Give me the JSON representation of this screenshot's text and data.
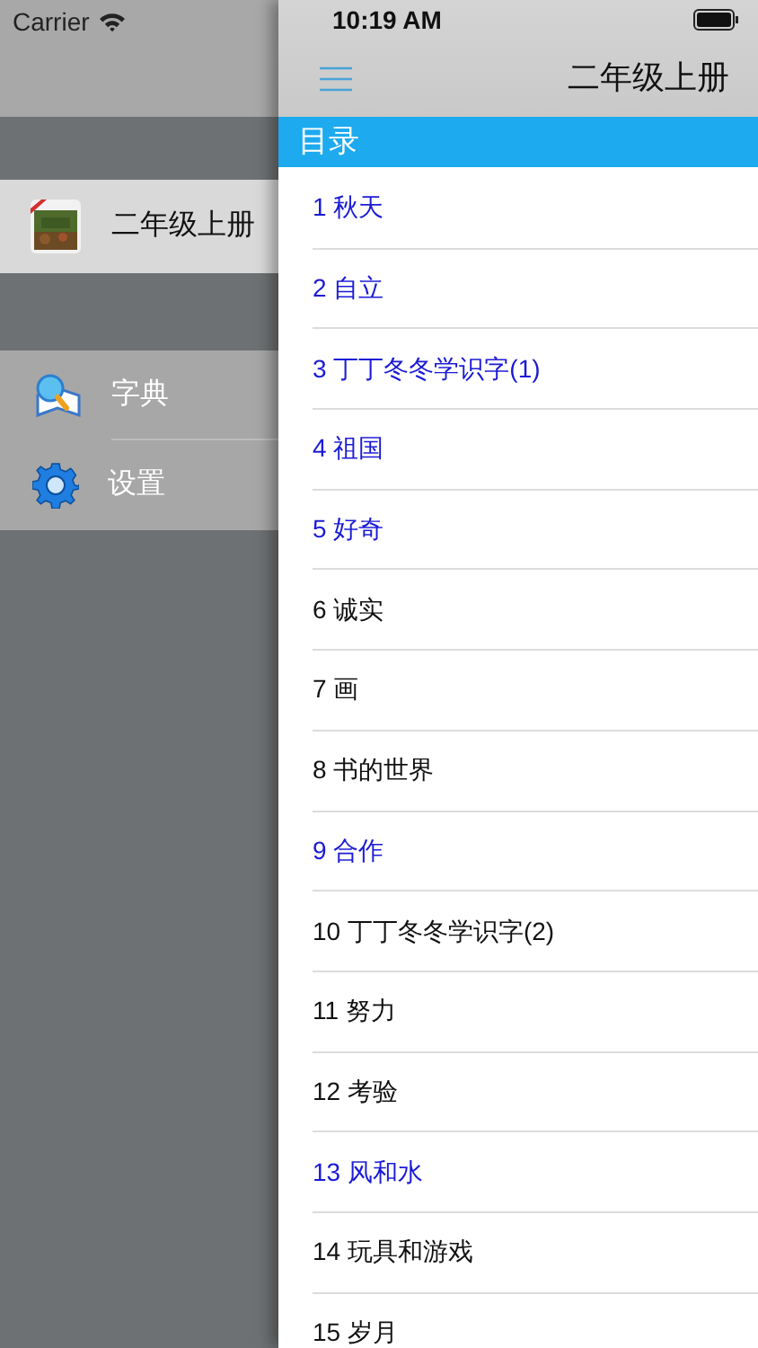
{
  "status_bar": {
    "carrier": "Carrier",
    "time": "10:19 AM"
  },
  "side_menu": {
    "books": [
      {
        "title": "二年级上册",
        "selected": true
      }
    ],
    "items": [
      {
        "kind": "dictionary",
        "label": "字典"
      },
      {
        "kind": "settings",
        "label": "设置"
      }
    ]
  },
  "header": {
    "title": "二年级上册"
  },
  "section": {
    "title": "目录"
  },
  "lessons": [
    {
      "title": "1 秋天",
      "color": "#1a1ad6"
    },
    {
      "title": "2 自立",
      "color": "#1a1ad6"
    },
    {
      "title": "3 丁丁冬冬学识字(1)",
      "color": "#1a1ad6"
    },
    {
      "title": "4 祖国",
      "color": "#1a1ad6"
    },
    {
      "title": "5 好奇",
      "color": "#1a1ad6"
    },
    {
      "title": "6 诚实",
      "color": "#111111"
    },
    {
      "title": "7 画",
      "color": "#111111"
    },
    {
      "title": "8 书的世界",
      "color": "#111111"
    },
    {
      "title": "9 合作",
      "color": "#1a1ad6"
    },
    {
      "title": "10 丁丁冬冬学识字(2)",
      "color": "#111111"
    },
    {
      "title": "11 努力",
      "color": "#111111"
    },
    {
      "title": "12 考验",
      "color": "#111111"
    },
    {
      "title": "13 风和水",
      "color": "#1a1ad6"
    },
    {
      "title": "14 玩具和游戏",
      "color": "#111111"
    },
    {
      "title": "15 岁月",
      "color": "#111111"
    }
  ]
}
